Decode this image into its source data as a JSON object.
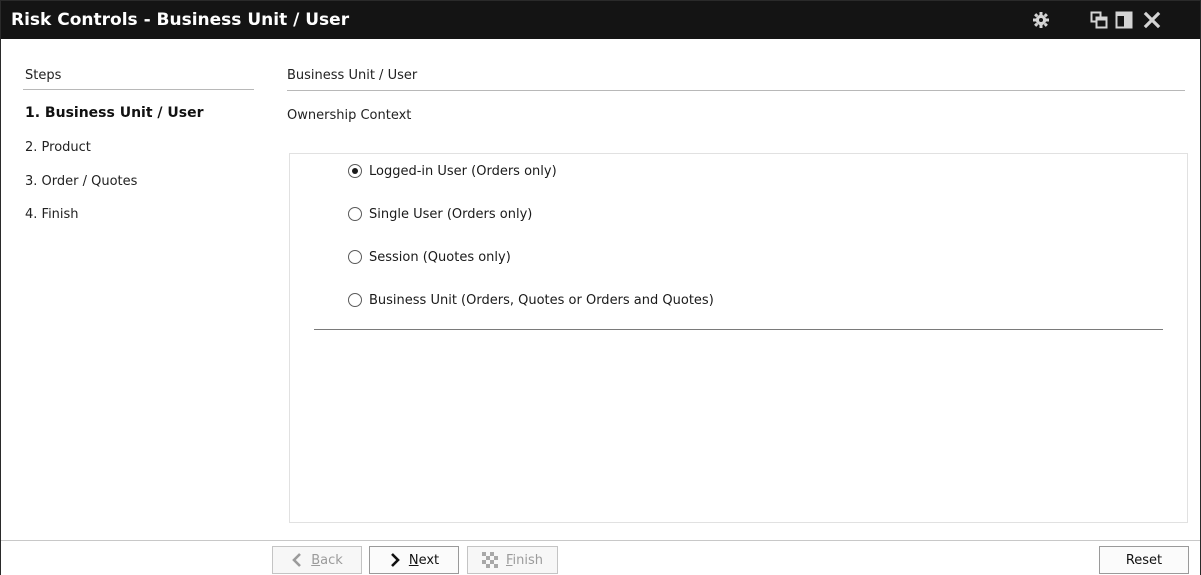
{
  "window": {
    "title": "Risk Controls - Business Unit / User",
    "icons": [
      "gear-icon",
      "restore-icon",
      "dock-icon",
      "close-icon"
    ]
  },
  "steps": {
    "header": "Steps",
    "items": [
      {
        "label": "1. Business Unit / User",
        "active": true
      },
      {
        "label": "2. Product",
        "active": false
      },
      {
        "label": "3. Order / Quotes",
        "active": false
      },
      {
        "label": "4. Finish",
        "active": false
      }
    ]
  },
  "main": {
    "section_title": "Business Unit / User",
    "context_label": "Ownership Context",
    "options": [
      {
        "label": "Logged-in User (Orders only)",
        "checked": true
      },
      {
        "label": "Single User (Orders only)",
        "checked": false
      },
      {
        "label": "Session (Quotes only)",
        "checked": false
      },
      {
        "label": "Business Unit (Orders, Quotes or Orders and Quotes)",
        "checked": false
      }
    ]
  },
  "footer": {
    "back_mnemonic": "B",
    "back_rest": "ack",
    "next_mnemonic": "N",
    "next_rest": "ext",
    "finish_mnemonic": "F",
    "finish_rest": "inish",
    "reset_label": "Reset"
  },
  "colors": {
    "titlebar_bg": "#141414",
    "titlebar_text": "#ffffff",
    "disabled_text": "#9b9b9b"
  }
}
